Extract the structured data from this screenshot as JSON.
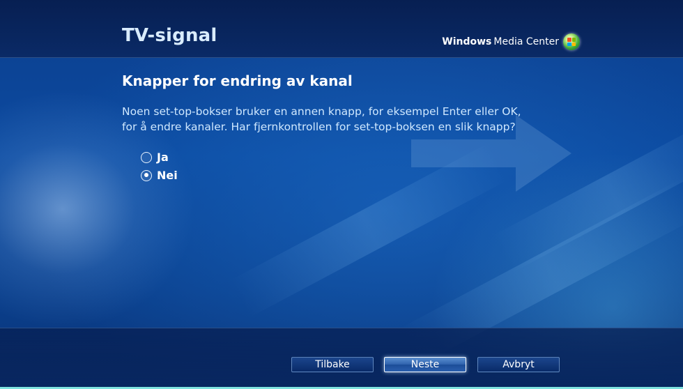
{
  "header": {
    "title": "TV-signal",
    "brand_bold": "Windows",
    "brand_rest": "Media Center"
  },
  "content": {
    "heading": "Knapper for endring av kanal",
    "question_line1": "Noen set-top-bokser bruker en annen knapp, for eksempel Enter eller OK,",
    "question_line2": "for å endre kanaler. Har fjernkontrollen for set-top-boksen en slik knapp?",
    "options": [
      {
        "label": "Ja",
        "selected": false
      },
      {
        "label": "Nei",
        "selected": true
      }
    ]
  },
  "footer": {
    "back_label": "Tilbake",
    "next_label": "Neste",
    "cancel_label": "Avbryt"
  },
  "colors": {
    "background": "#0b4aa0",
    "header_band": "#071f52",
    "title_text": "#d9ecff",
    "focus_button": "#2f62ad",
    "bottom_accent": "#7fe3e0"
  },
  "icons": {
    "logo": "windows-media-center-orb-icon",
    "background_graphic": "arrow-right-icon"
  }
}
